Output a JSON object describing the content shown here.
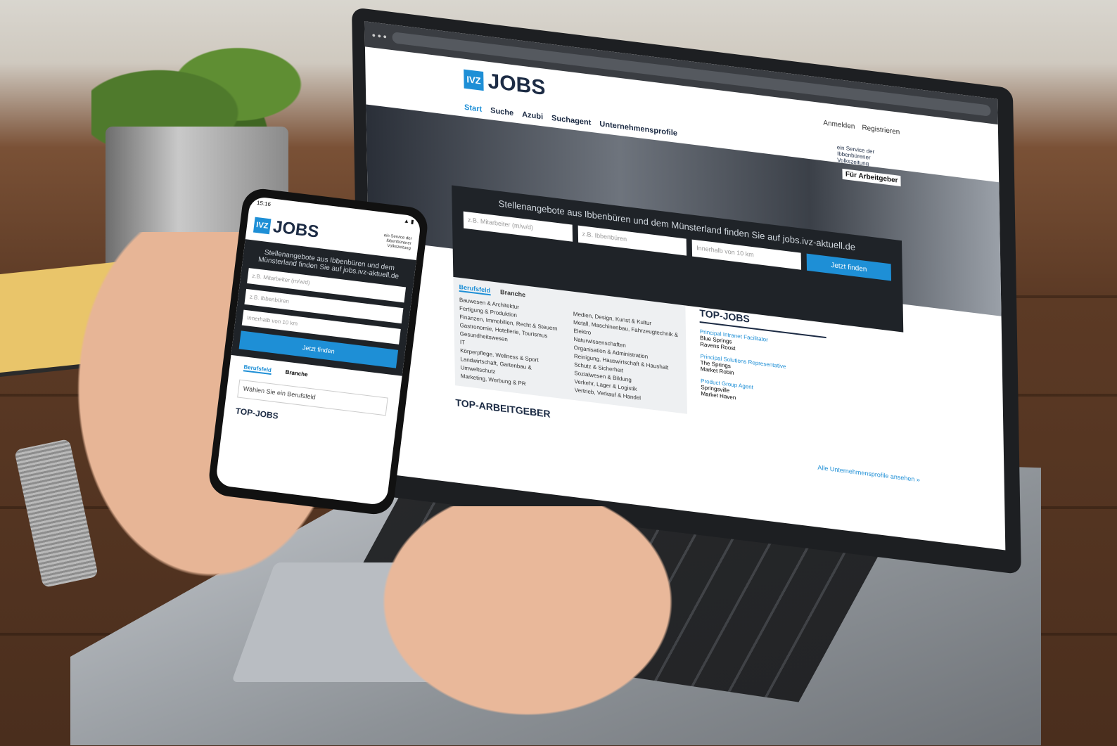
{
  "laptop": {
    "header": {
      "logo_box": "IVZ",
      "logo_text": "JOBS",
      "login": "Anmelden",
      "register": "Registrieren"
    },
    "nav": [
      "Start",
      "Suche",
      "Azubi",
      "Suchagent",
      "Unternehmensprofile"
    ],
    "employer_link": "Für Arbeitgeber",
    "tagline": "ein Service der Ibbenbürener Volkszeitung",
    "search": {
      "title": "Stellenangebote aus Ibbenbüren und dem Münsterland finden Sie auf jobs.ivz-aktuell.de",
      "job_placeholder": "z.B. Mitarbeiter (m/w/d)",
      "location_placeholder": "z.B. Ibbenbüren",
      "radius_value": "Innerhalb von 10 km",
      "button": "Jetzt finden"
    },
    "tabs": [
      "Berufsfeld",
      "Branche"
    ],
    "categories_left": [
      "Bauwesen & Architektur",
      "Fertigung & Produktion",
      "Finanzen, Immobilien, Recht & Steuern",
      "Gastronomie, Hotellerie, Tourismus",
      "Gesundheitswesen",
      "IT",
      "Körperpflege, Wellness & Sport",
      "Landwirtschaft, Gartenbau & Umweltschutz",
      "Marketing, Werbung & PR"
    ],
    "categories_right": [
      "Medien, Design, Kunst & Kultur",
      "Metall, Maschinenbau, Fahrzeugtechnik & Elektro",
      "Naturwissenschaften",
      "Organisation & Administration",
      "Reinigung, Hauswirtschaft & Haushalt",
      "Schutz & Sicherheit",
      "Sozialwesen & Bildung",
      "Verkehr, Lager & Logistik",
      "Vertrieb, Verkauf & Handel"
    ],
    "top_jobs": {
      "title": "TOP-JOBS",
      "items": [
        {
          "title": "Principal Intranet Facilitator",
          "company": "Blue Springs",
          "place": "Ravens Roost"
        },
        {
          "title": "Principal Solutions Representative",
          "company": "The Springs",
          "place": "Market Robin"
        },
        {
          "title": "Product Group Agent",
          "company": "Springsville",
          "place": "Market Haven"
        }
      ]
    },
    "top_employers": "TOP-ARBEITGEBER",
    "all_profiles": "Alle Unternehmensprofile ansehen »"
  },
  "phone": {
    "time": "15:16",
    "logo_box": "IVZ",
    "logo_text": "JOBS",
    "tagline": "ein Service der Ibbenbürener Volkszeitung",
    "search_title": "Stellenangebote aus Ibbenbüren und dem Münsterland finden Sie auf jobs.ivz-aktuell.de",
    "job_placeholder": "z.B. Mitarbeiter (m/w/d)",
    "location_placeholder": "z.B. Ibbenbüren",
    "radius_value": "Innerhalb von 10 km",
    "button": "Jetzt finden",
    "tabs": [
      "Berufsfeld",
      "Branche"
    ],
    "select_value": "Wählen Sie ein Berufsfeld",
    "top_jobs": "TOP-JOBS"
  },
  "colors": {
    "brand_blue": "#1e8fd6",
    "navy": "#1c2b44",
    "dark_panel": "#1f2328"
  }
}
